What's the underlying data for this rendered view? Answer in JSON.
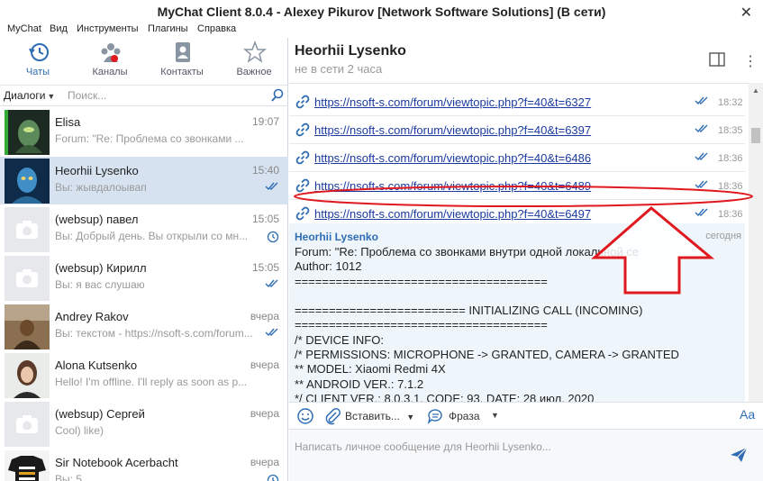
{
  "window": {
    "title": "MyChat Client 8.0.4 - Alexey Pikurov [Network Software Solutions] (В сети)",
    "close_glyph": "✕"
  },
  "menu": [
    "MyChat",
    "Вид",
    "Инструменты",
    "Плагины",
    "Справка"
  ],
  "nav_tabs": [
    {
      "label": "Чаты",
      "icon": "history-icon"
    },
    {
      "label": "Каналы",
      "icon": "channels-icon"
    },
    {
      "label": "Контакты",
      "icon": "contacts-icon"
    },
    {
      "label": "Важное",
      "icon": "star-icon"
    }
  ],
  "filter": {
    "dropdown_label": "Диалоги",
    "search_placeholder": "Поиск..."
  },
  "conversations": [
    {
      "name": "Elisa",
      "time": "19:07",
      "preview": "Forum: \"Re: Проблема со звонками ...",
      "status": "none",
      "avatar": "photo-dark"
    },
    {
      "name": "Heorhii Lysenko",
      "time": "15:40",
      "preview": "Вы: жывдалоывап",
      "status": "read-ticks",
      "avatar": "photo-blue"
    },
    {
      "name": "(websup) павел",
      "time": "15:05",
      "preview": "Вы: Добрый день. Вы открыли со мн...",
      "status": "clock",
      "avatar": "camera-placeholder"
    },
    {
      "name": "(websup) Кирилл",
      "time": "15:05",
      "preview": "Вы: я вас слушаю",
      "status": "read-ticks",
      "avatar": "camera-placeholder"
    },
    {
      "name": "Andrey Rakov",
      "time": "вчера",
      "preview": "Вы: текстом - https://nsoft-s.com/forum...",
      "status": "read-ticks",
      "avatar": "photo-brown"
    },
    {
      "name": "Alona Kutsenko",
      "time": "вчера",
      "preview": "Hello! I'm offline. I'll reply as soon as p...",
      "status": "none",
      "avatar": "photo-light"
    },
    {
      "name": "(websup) Сергей",
      "time": "вчера",
      "preview": "Cool) like)",
      "status": "none",
      "avatar": "camera-placeholder"
    },
    {
      "name": "Sir Notebook Acerbacht",
      "time": "вчера",
      "preview": "Вы: 5",
      "status": "clock",
      "avatar": "photo-shirt"
    }
  ],
  "chat": {
    "name": "Heorhii Lysenko",
    "status": "не в сети 2 часа"
  },
  "messages": [
    {
      "link": "https://nsoft-s.com/forum/viewtopic.php?f=40&t=6327",
      "time": "18:32"
    },
    {
      "link": "https://nsoft-s.com/forum/viewtopic.php?f=40&t=6397",
      "time": "18:35"
    },
    {
      "link": "https://nsoft-s.com/forum/viewtopic.php?f=40&t=6486",
      "time": "18:36"
    },
    {
      "link": "https://nsoft-s.com/forum/viewtopic.php?f=40&t=6489",
      "time": "18:36"
    },
    {
      "link": "https://nsoft-s.com/forum/viewtopic.php?f=40&t=6497",
      "time": "18:36"
    }
  ],
  "big_message": {
    "sender": "Heorhii Lysenko",
    "day": "сегодня",
    "lines": [
      "Forum: \"Re: Проблема со звонками внутри одной локальной се",
      "Author: 1012",
      "=====================================",
      "",
      "========================= INITIALIZING CALL (INCOMING)",
      "=====================================",
      "/* DEVICE INFO:",
      "/* PERMISSIONS: MICROPHONE -> GRANTED, CAMERA -> GRANTED",
      "** MODEL: Xiaomi Redmi 4X",
      "** ANDROID VER.: 7.1.2",
      "*/ CLIENT VER.: 8.0.3.1, CODE: 93, DATE: 28 июл. 2020"
    ]
  },
  "toolbar": {
    "insert_label": "Вставить...",
    "phrase_label": "Фраза",
    "font_glyph": "Aa"
  },
  "input": {
    "placeholder": "Написать личное сообщение для Heorhii Lysenko..."
  },
  "colors": {
    "accent": "#2e6db4",
    "link": "#1a3aa0",
    "selected": "#d6e2f0",
    "annotation": "#e0191f"
  }
}
